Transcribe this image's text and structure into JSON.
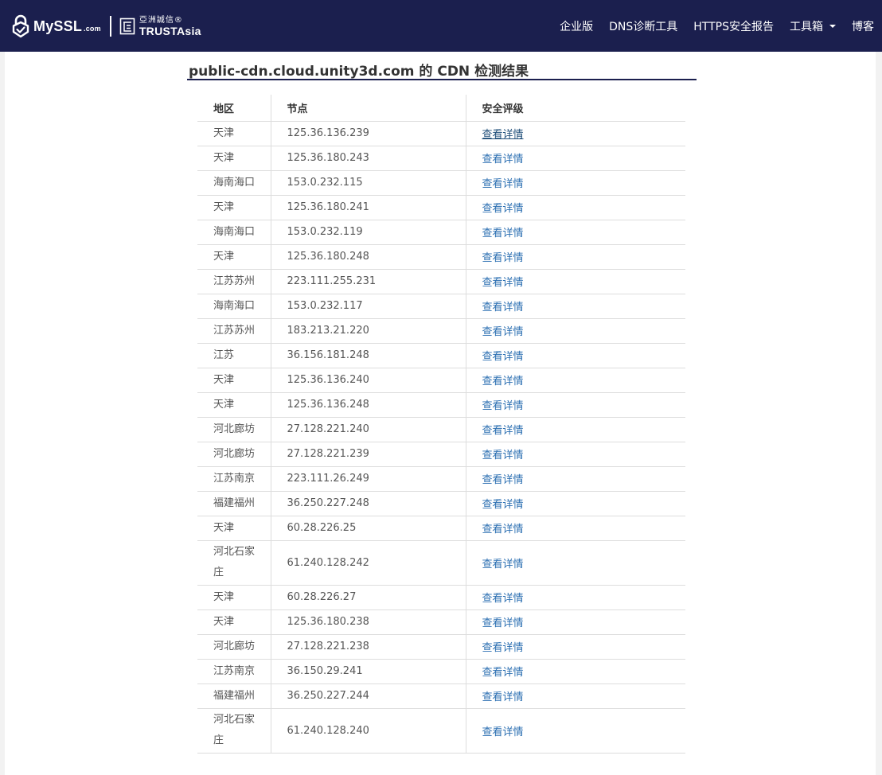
{
  "header": {
    "logo_brand": "MySSL",
    "logo_brand_suffix": ".com",
    "partner_cn": "亞洲誠信®",
    "partner_en": "TRUSTAsia",
    "nav": [
      {
        "label": "企业版"
      },
      {
        "label": "DNS诊断工具"
      },
      {
        "label": "HTTPS安全报告"
      },
      {
        "label": "工具箱"
      },
      {
        "label": "博客"
      }
    ]
  },
  "page": {
    "title": "public-cdn.cloud.unity3d.com 的 CDN 检测结果"
  },
  "table": {
    "headers": {
      "region": "地区",
      "node": "节点",
      "rating": "安全评级"
    },
    "rows": [
      {
        "region": "天津",
        "node": "125.36.136.239",
        "link": "查看详情"
      },
      {
        "region": "天津",
        "node": "125.36.180.243",
        "link": "查看详情"
      },
      {
        "region": "海南海口",
        "node": "153.0.232.115",
        "link": "查看详情"
      },
      {
        "region": "天津",
        "node": "125.36.180.241",
        "link": "查看详情"
      },
      {
        "region": "海南海口",
        "node": "153.0.232.119",
        "link": "查看详情"
      },
      {
        "region": "天津",
        "node": "125.36.180.248",
        "link": "查看详情"
      },
      {
        "region": "江苏苏州",
        "node": "223.111.255.231",
        "link": "查看详情"
      },
      {
        "region": "海南海口",
        "node": "153.0.232.117",
        "link": "查看详情"
      },
      {
        "region": "江苏苏州",
        "node": "183.213.21.220",
        "link": "查看详情"
      },
      {
        "region": "江苏",
        "node": "36.156.181.248",
        "link": "查看详情"
      },
      {
        "region": "天津",
        "node": "125.36.136.240",
        "link": "查看详情"
      },
      {
        "region": "天津",
        "node": "125.36.136.248",
        "link": "查看详情"
      },
      {
        "region": "河北廊坊",
        "node": "27.128.221.240",
        "link": "查看详情"
      },
      {
        "region": "河北廊坊",
        "node": "27.128.221.239",
        "link": "查看详情"
      },
      {
        "region": "江苏南京",
        "node": "223.111.26.249",
        "link": "查看详情"
      },
      {
        "region": "福建福州",
        "node": "36.250.227.248",
        "link": "查看详情"
      },
      {
        "region": "天津",
        "node": "60.28.226.25",
        "link": "查看详情"
      },
      {
        "region": "河北石家庄",
        "node": "61.240.128.242",
        "link": "查看详情"
      },
      {
        "region": "天津",
        "node": "60.28.226.27",
        "link": "查看详情"
      },
      {
        "region": "天津",
        "node": "125.36.180.238",
        "link": "查看详情"
      },
      {
        "region": "河北廊坊",
        "node": "27.128.221.238",
        "link": "查看详情"
      },
      {
        "region": "江苏南京",
        "node": "36.150.29.241",
        "link": "查看详情"
      },
      {
        "region": "福建福州",
        "node": "36.250.227.244",
        "link": "查看详情"
      },
      {
        "region": "河北石家庄",
        "node": "61.240.128.240",
        "link": "查看详情"
      }
    ]
  }
}
